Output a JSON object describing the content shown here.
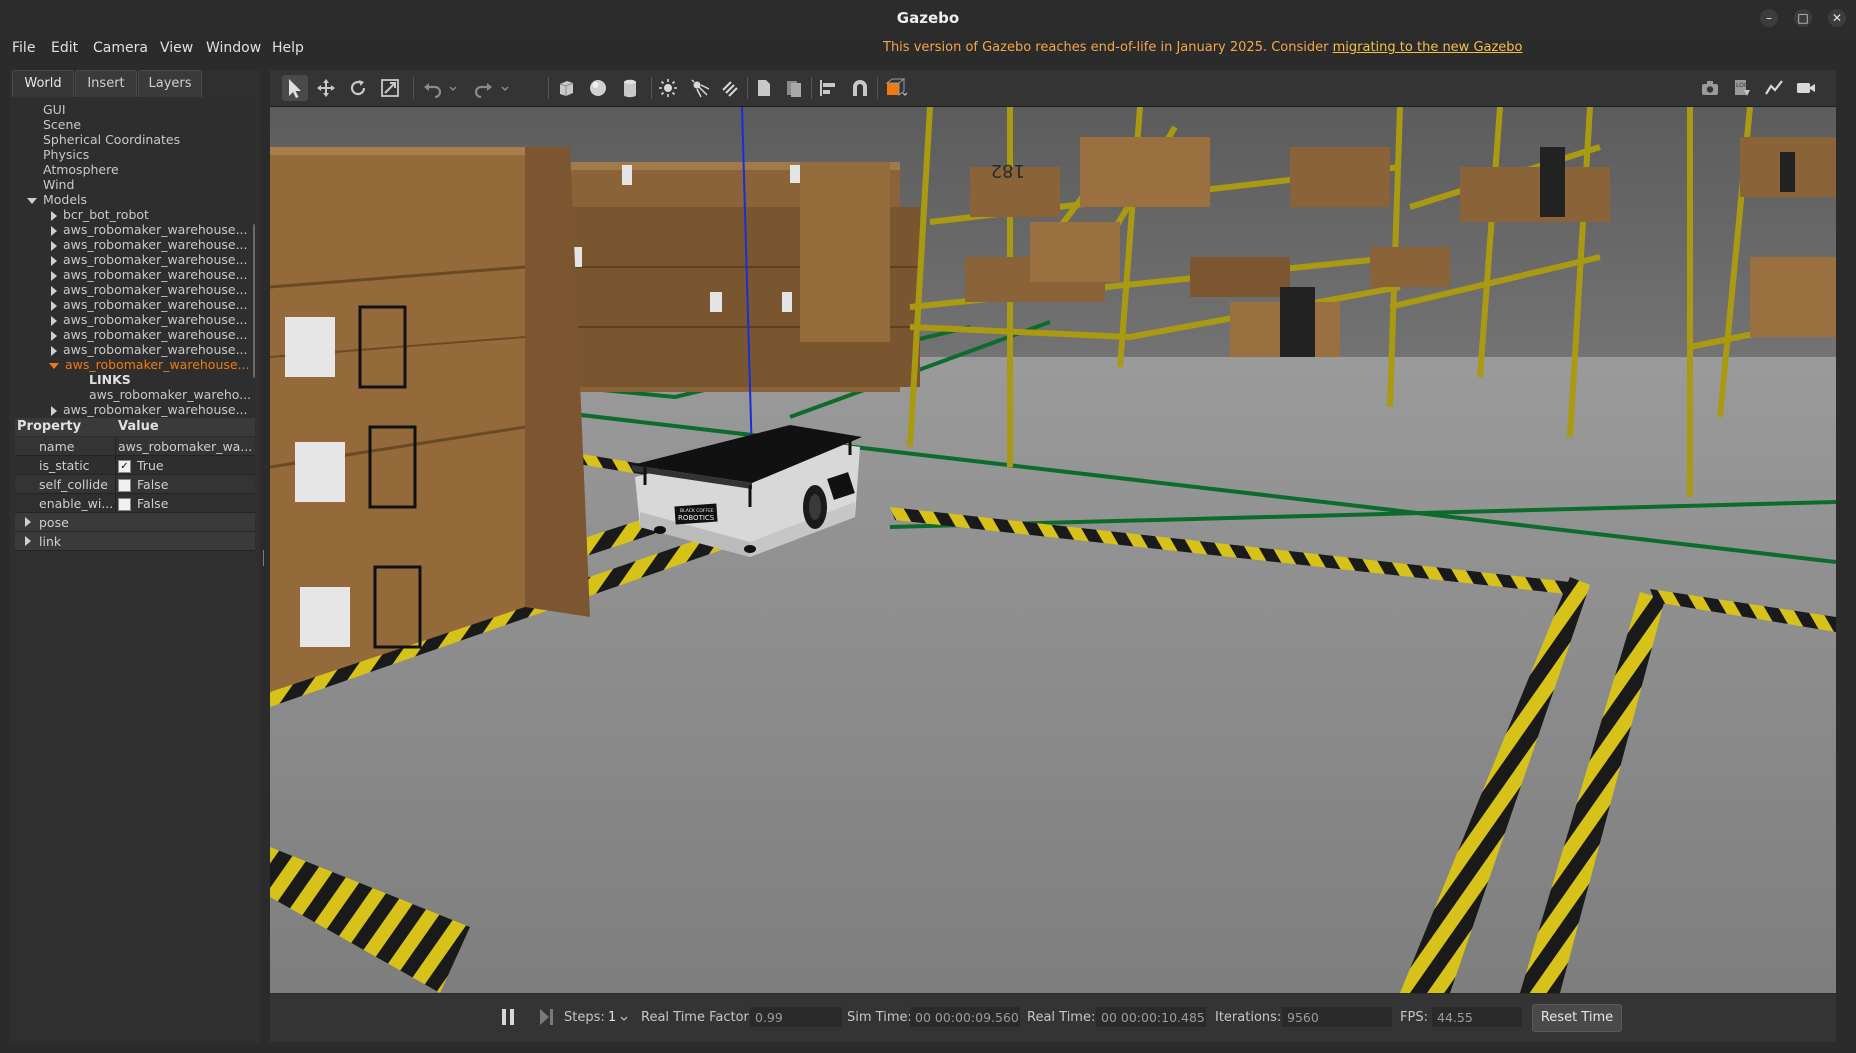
{
  "window": {
    "title": "Gazebo"
  },
  "menu": {
    "file": "File",
    "edit": "Edit",
    "camera": "Camera",
    "view": "View",
    "window": "Window",
    "help": "Help",
    "eol_text": "This version of Gazebo reaches end-of-life in January 2025. Consider ",
    "eol_link": "migrating to the new Gazebo"
  },
  "tabs": {
    "world": "World",
    "insert": "Insert",
    "layers": "Layers"
  },
  "tree": {
    "items": [
      "GUI",
      "Scene",
      "Spherical Coordinates",
      "Physics",
      "Atmosphere",
      "Wind"
    ],
    "models_label": "Models",
    "models": [
      "bcr_bot_robot",
      "aws_robomaker_warehouse...",
      "aws_robomaker_warehouse...",
      "aws_robomaker_warehouse...",
      "aws_robomaker_warehouse...",
      "aws_robomaker_warehouse...",
      "aws_robomaker_warehouse...",
      "aws_robomaker_warehouse...",
      "aws_robomaker_warehouse...",
      "aws_robomaker_warehouse..."
    ],
    "selected_model": "aws_robomaker_warehouse...",
    "links_label": "LINKS",
    "link_item": "aws_robomaker_wareho...",
    "last_model": "aws_robomaker_warehouse..."
  },
  "properties": {
    "header_property": "Property",
    "header_value": "Value",
    "rows": [
      {
        "name": "name",
        "value": "aws_robomaker_wa..."
      },
      {
        "name": "is_static",
        "value": "True",
        "checked": "✓"
      },
      {
        "name": "self_collide",
        "value": "False"
      },
      {
        "name": "enable_wi...",
        "value": "False"
      }
    ],
    "pose": "pose",
    "link": "link"
  },
  "robot": {
    "brand_line1": "BLACK COFFEE",
    "brand_line2": "ROBOTICS"
  },
  "boxes": {
    "label": "182"
  },
  "sim": {
    "steps_label": "Steps:",
    "steps_value": "1",
    "rtf_label": "Real Time Factor:",
    "rtf_value": "0.99",
    "sim_time_label": "Sim Time:",
    "sim_time_value": "00 00:00:09.560",
    "real_time_label": "Real Time:",
    "real_time_value": "00 00:00:10.485",
    "iterations_label": "Iterations:",
    "iterations_value": "9560",
    "fps_label": "FPS:",
    "fps_value": "44.55",
    "reset_label": "Reset Time"
  },
  "colors": {
    "accent_orange": "#f07a10",
    "eol_orange": "#f5a64a",
    "shelf_yellow": "#a99a12",
    "floor_gray": "#8c8c8c",
    "floor_line_green": "#0d6b2c",
    "hazard_yellow": "#d7c21a",
    "box_brown": "#8a6438"
  },
  "icons": [
    "select-arrow-icon",
    "translate-icon",
    "rotate-icon",
    "scale-icon",
    "undo-icon",
    "redo-icon",
    "box-shape-icon",
    "sphere-shape-icon",
    "cylinder-shape-icon",
    "point-light-icon",
    "spot-light-icon",
    "directional-light-icon",
    "copy-icon",
    "paste-icon",
    "align-icon",
    "snap-magnet-icon",
    "view-angle-icon",
    "screenshot-camera-icon",
    "log-icon",
    "plot-icon",
    "record-video-icon"
  ]
}
